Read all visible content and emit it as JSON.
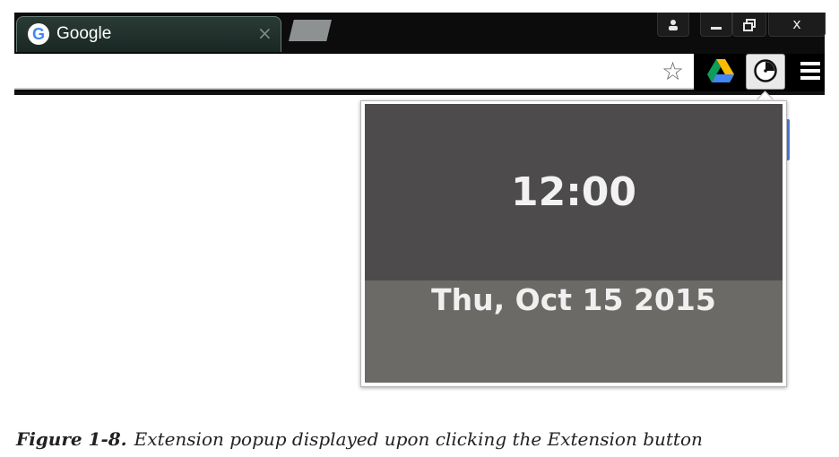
{
  "browser": {
    "tab": {
      "title": "Google",
      "favicon": "google-g-icon",
      "close_label": "×"
    },
    "window_controls": {
      "user": "user-icon",
      "minimize": "minimize-icon",
      "restore": "restore-icon",
      "close_label": "x"
    },
    "toolbar": {
      "star": "star-icon",
      "drive": "google-drive-icon",
      "extension": "clock-extension-icon",
      "menu": "menu-icon"
    }
  },
  "popup": {
    "time": "12:00",
    "date": "Thu, Oct 15 2015",
    "colors": {
      "clock_bg": "#4d4b4b",
      "date_bg": "#6b6a66",
      "text": "#f2f2f2"
    }
  },
  "caption": {
    "label": "Figure 1-8.",
    "text": "Extension popup displayed upon clicking the Extension button"
  }
}
